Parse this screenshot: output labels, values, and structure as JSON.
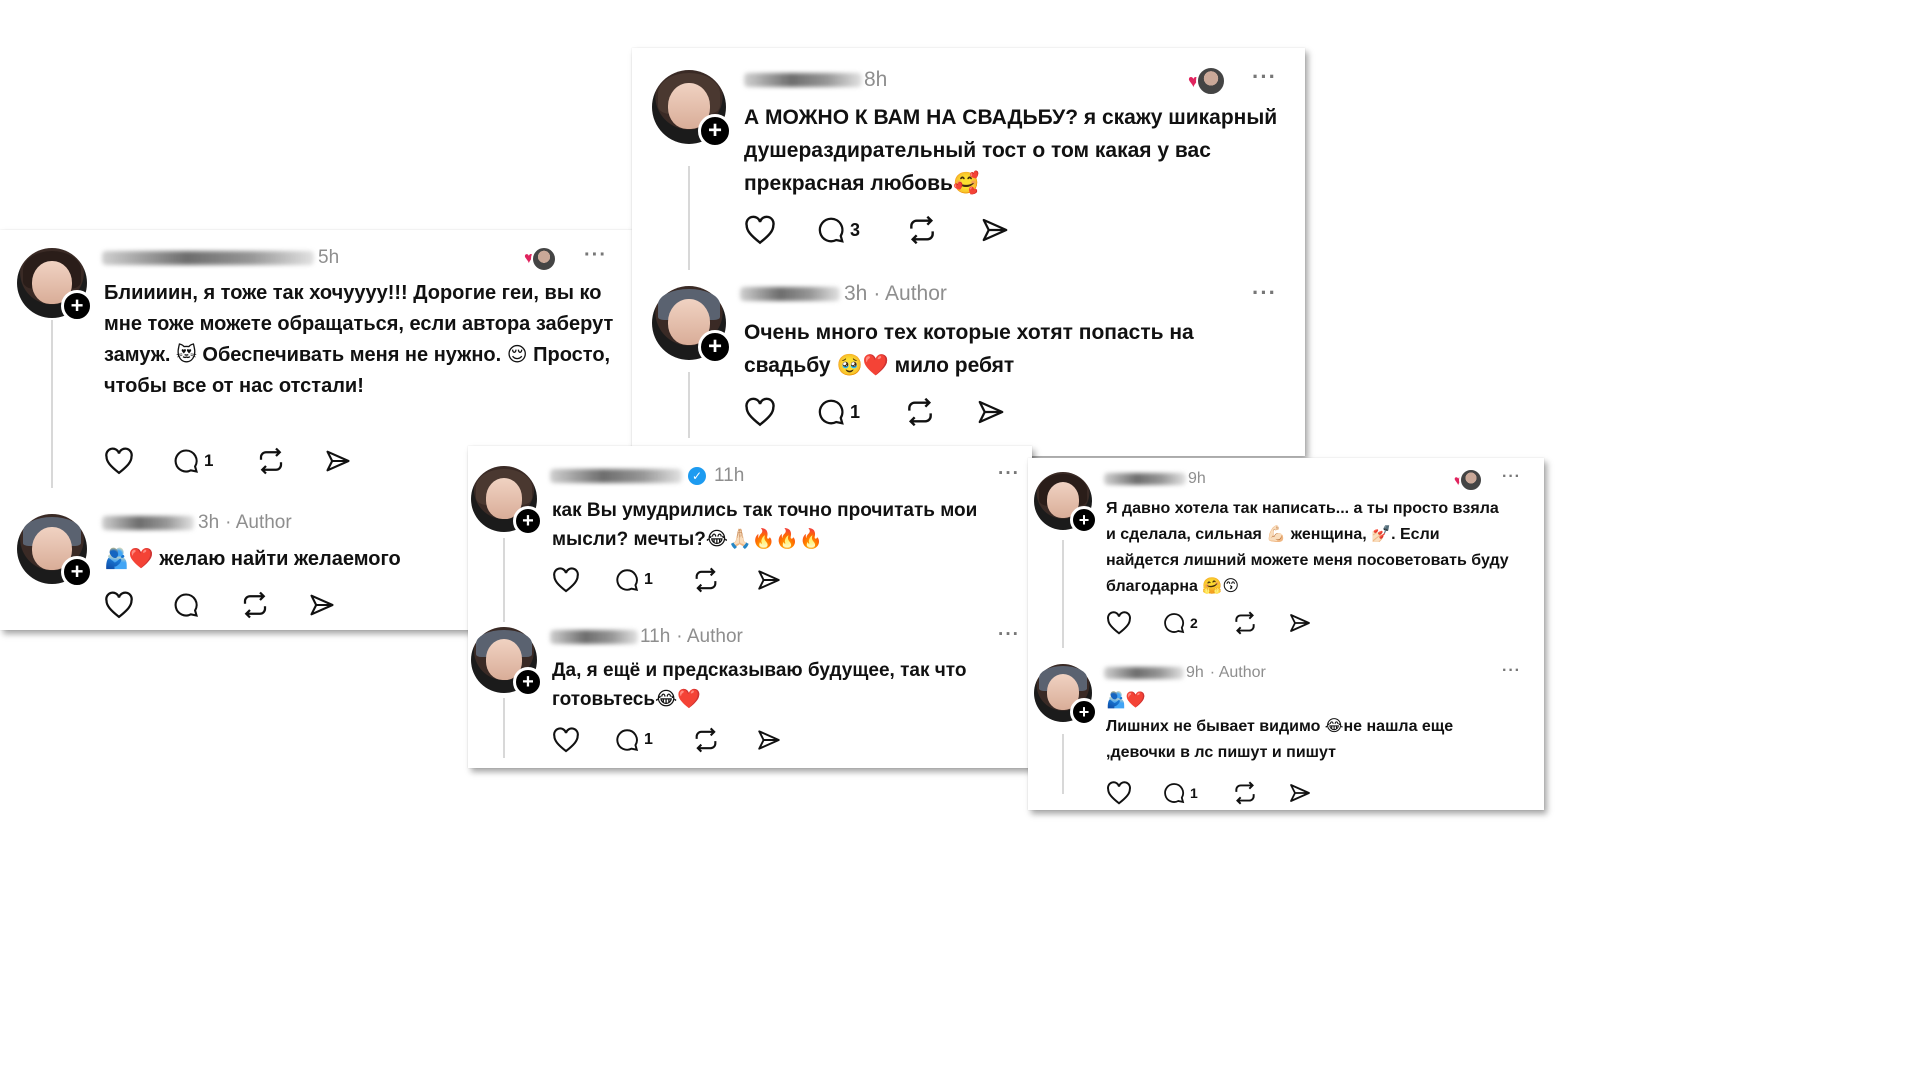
{
  "colors": {
    "heart": "#e0245e",
    "verified": "#1d9bf0",
    "meta": "#8e8e8e"
  },
  "cards": {
    "c1": {
      "comment": {
        "time": "5h",
        "text": "Блиииин, я тоже так хочуууу!!! Дорогие  геи, вы ко мне тоже можете обращаться, если автора заберут замуж. 😻 Обеспечивать меня не нужно. 😌 Просто, чтобы все от нас отстали!",
        "replies": "1",
        "more": "···"
      },
      "reply": {
        "time": "3h",
        "author_label": "· Author",
        "text": "🫂❤️ желаю найти желаемого",
        "more": ""
      }
    },
    "c2": {
      "comment": {
        "time": "8h",
        "text": "А МОЖНО К ВАМ НА СВАДЬБУ? я скажу шикарный душераздирательный тост о том какая у вас прекрасная любовь🥰",
        "replies": "3",
        "more": "···"
      },
      "reply": {
        "time": "3h",
        "author_label": "· Author",
        "text": "Очень много тех которые хотят попасть на свадьбу 🥹❤️ мило ребят",
        "replies": "1",
        "more": "···"
      }
    },
    "c3": {
      "comment": {
        "time": "11h",
        "text": "как Вы умудрились так точно прочитать мои мысли? мечты?😂🙏🏻🔥🔥🔥",
        "replies": "1",
        "more": "···"
      },
      "reply": {
        "time": "11h",
        "author_label": "· Author",
        "text": "Да, я ещё и предсказываю будущее, так что готовьтесь😂❤️",
        "replies": "1",
        "more": "···"
      }
    },
    "c4": {
      "comment": {
        "time": "9h",
        "text": "Я давно хотела так написать... а ты просто взяла и сделала, сильная 💪🏻 женщина, 💅🏻. Если найдется лишний можете меня посоветовать буду благодарна 🤗😙",
        "replies": "2",
        "more": "···"
      },
      "reply": {
        "time": "9h",
        "author_label": "· Author",
        "text": "🫂❤️\nЛишних не бывает видимо 😂не нашла еще ,девочки в лс пишут и пишут",
        "replies": "1",
        "more": "···"
      }
    }
  },
  "icons": [
    "plus-icon",
    "heart-icon",
    "comment-icon",
    "repost-icon",
    "share-icon",
    "more-icon",
    "verified-icon"
  ]
}
